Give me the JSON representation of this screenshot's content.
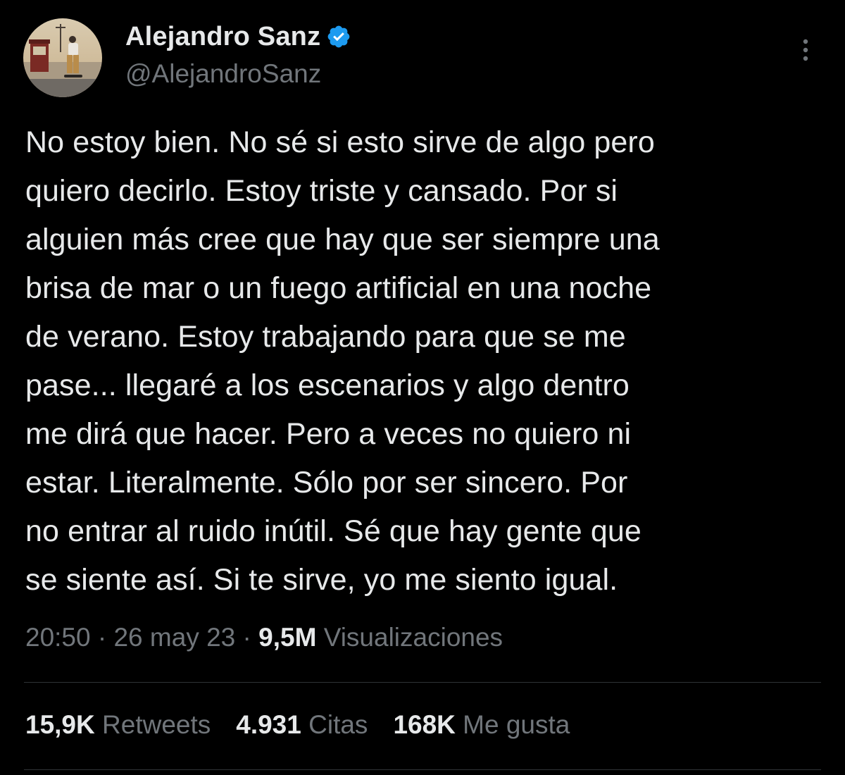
{
  "author": {
    "display_name": "Alejandro Sanz",
    "handle": "@AlejandroSanz",
    "verified_icon": "verified-badge-icon"
  },
  "tweet": {
    "text": "No estoy bien. No sé si esto sirve de algo pero\nquiero decirlo. Estoy triste y cansado. Por si\nalguien más cree que hay que ser siempre una\nbrisa de mar o un fuego artificial en una noche\nde verano. Estoy trabajando para que se me\npase... llegaré a los escenarios y algo dentro\nme dirá que hacer. Pero a veces no quiero ni\nestar. Literalmente. Sólo por ser sincero. Por\nno entrar al ruido inútil. Sé que hay gente que\nse siente así. Si te sirve, yo me siento igual.",
    "time": "20:50",
    "date": "26 may 23",
    "separator": "·",
    "views_count": "9,5M",
    "views_label": "Visualizaciones"
  },
  "stats": {
    "retweets_count": "15,9K",
    "retweets_label": "Retweets",
    "quotes_count": "4.931",
    "quotes_label": "Citas",
    "likes_count": "168K",
    "likes_label": "Me gusta"
  },
  "colors": {
    "background": "#000000",
    "text_primary": "#e7e9ea",
    "text_secondary": "#71767b",
    "verified_blue": "#1d9bf0",
    "divider": "#2f3336"
  }
}
